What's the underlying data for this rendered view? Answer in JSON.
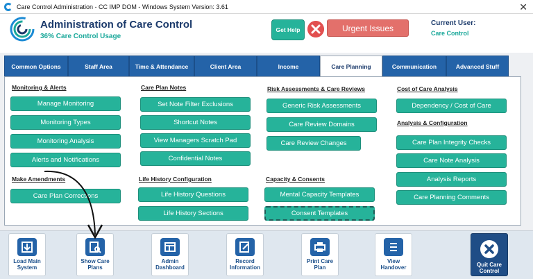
{
  "window": {
    "title": "Care Control Administration - CC IMP DOM - Windows System Version: 3.61",
    "close": "✕"
  },
  "header": {
    "title": "Administration of Care Control",
    "subtitle": "36% Care Control Usage",
    "help_label": "Get Help",
    "urgent_label": "Urgent Issues",
    "current_user_label": "Current User:",
    "current_user_value": "Care Control"
  },
  "tabs": [
    {
      "label": "Common Options"
    },
    {
      "label": "Staff Area"
    },
    {
      "label": "Time & Attendance"
    },
    {
      "label": "Client Area"
    },
    {
      "label": "Income"
    },
    {
      "label": "Care Planning",
      "active": true
    },
    {
      "label": "Communication"
    },
    {
      "label": "Advanced Stuff"
    }
  ],
  "sections": {
    "monitoring": {
      "heading": "Monitoring & Alerts",
      "buttons": [
        "Manage Monitoring",
        "Monitoring Types",
        "Monitoring Analysis",
        "Alerts and Notifications"
      ]
    },
    "make_amendments": {
      "heading": "Make Amendments",
      "buttons": [
        "Care Plan Corrections"
      ]
    },
    "care_plan_notes": {
      "heading": "Care Plan Notes",
      "buttons": [
        "Set Note Filter Exclusions",
        "Shortcut Notes",
        "View Managers Scratch Pad",
        "Confidential Notes"
      ]
    },
    "life_history": {
      "heading": "Life History Configuration",
      "buttons": [
        "Life History Questions",
        "Life History Sections"
      ]
    },
    "risk": {
      "heading": "Risk Assessments & Care Reviews",
      "buttons": [
        "Generic Risk Assessments",
        "Care Review Domains",
        "Care Review Changes"
      ]
    },
    "capacity": {
      "heading": "Capacity & Consents",
      "buttons": [
        "Mental Capacity Templates",
        "Consent Templates"
      ]
    },
    "cost": {
      "heading": "Cost of Care Analysis",
      "buttons": [
        "Dependency / Cost of Care"
      ]
    },
    "analysis": {
      "heading": "Analysis & Configuration",
      "buttons": [
        "Care Plan Integrity Checks",
        "Care Note Analysis",
        "Analysis Reports",
        "Care Planning Comments"
      ]
    }
  },
  "dock": [
    {
      "label": "Load Main System",
      "icon": "load-system-icon"
    },
    {
      "label": "Show Care Plans",
      "icon": "care-plans-icon"
    },
    {
      "label": "Admin Dashboard",
      "icon": "dashboard-icon"
    },
    {
      "label": "Record Information",
      "icon": "record-icon"
    },
    {
      "label": "Print Care Plan",
      "icon": "printer-icon"
    },
    {
      "label": "View Handover",
      "icon": "handover-icon"
    },
    {
      "label": "Quit Care Control",
      "icon": "quit-icon"
    }
  ],
  "colors": {
    "accent": "#26b39a",
    "tab": "#2463a8",
    "urgent": "#e3706b",
    "title": "#1b3a6b"
  }
}
